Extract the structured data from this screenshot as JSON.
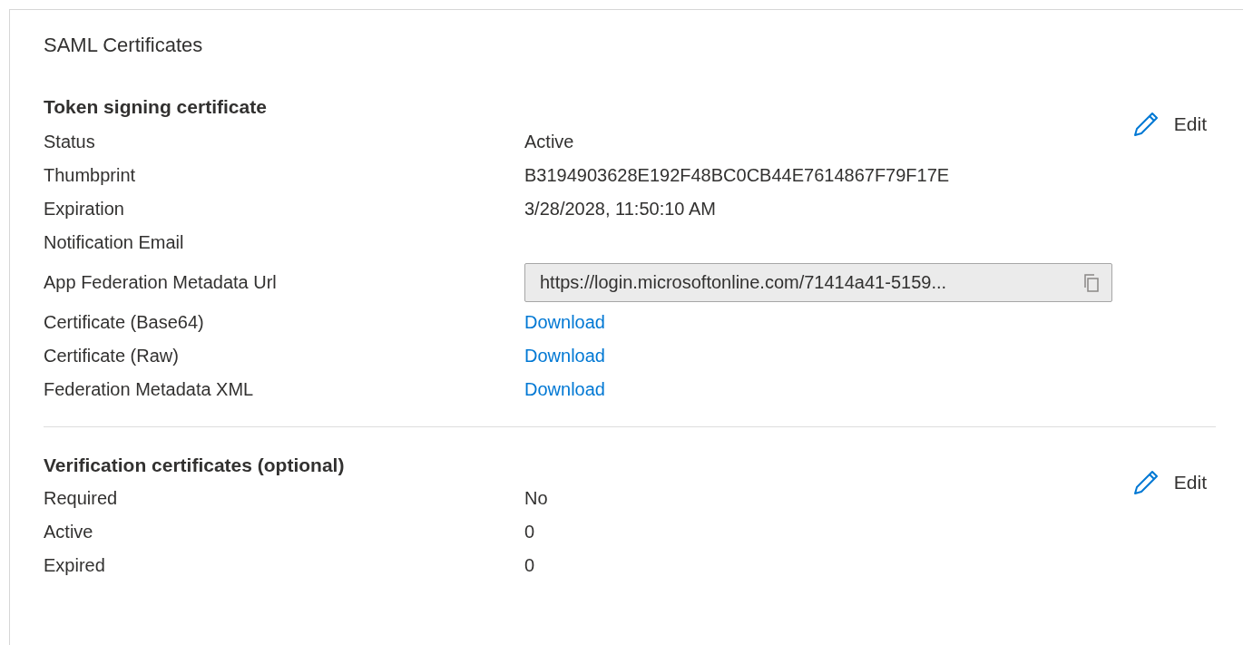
{
  "title": "SAML Certificates",
  "sections": [
    {
      "heading": "Token signing certificate",
      "edit": "Edit",
      "rows": [
        {
          "kind": "text",
          "label": "Status",
          "value": "Active"
        },
        {
          "kind": "text",
          "label": "Thumbprint",
          "value": "B3194903628E192F48BC0CB44E7614867F79F17E"
        },
        {
          "kind": "text",
          "label": "Expiration",
          "value": "3/28/2028, 11:50:10 AM"
        },
        {
          "kind": "text",
          "label": "Notification Email"
        },
        {
          "kind": "field",
          "label": "App Federation Metadata Url",
          "value": "https://login.microsoftonline.com/71414a41-5159..."
        },
        {
          "kind": "link",
          "label": "Certificate (Base64)",
          "value": "Download"
        },
        {
          "kind": "link",
          "label": "Certificate (Raw)",
          "value": "Download"
        },
        {
          "kind": "link",
          "label": "Federation Metadata XML",
          "value": "Download"
        }
      ]
    },
    {
      "heading": "Verification certificates (optional)",
      "edit": "Edit",
      "rows": [
        {
          "kind": "text",
          "label": "Required",
          "value": "No"
        },
        {
          "kind": "text",
          "label": "Active",
          "value": "0"
        },
        {
          "kind": "text",
          "label": "Expired",
          "value": "0"
        }
      ]
    }
  ]
}
